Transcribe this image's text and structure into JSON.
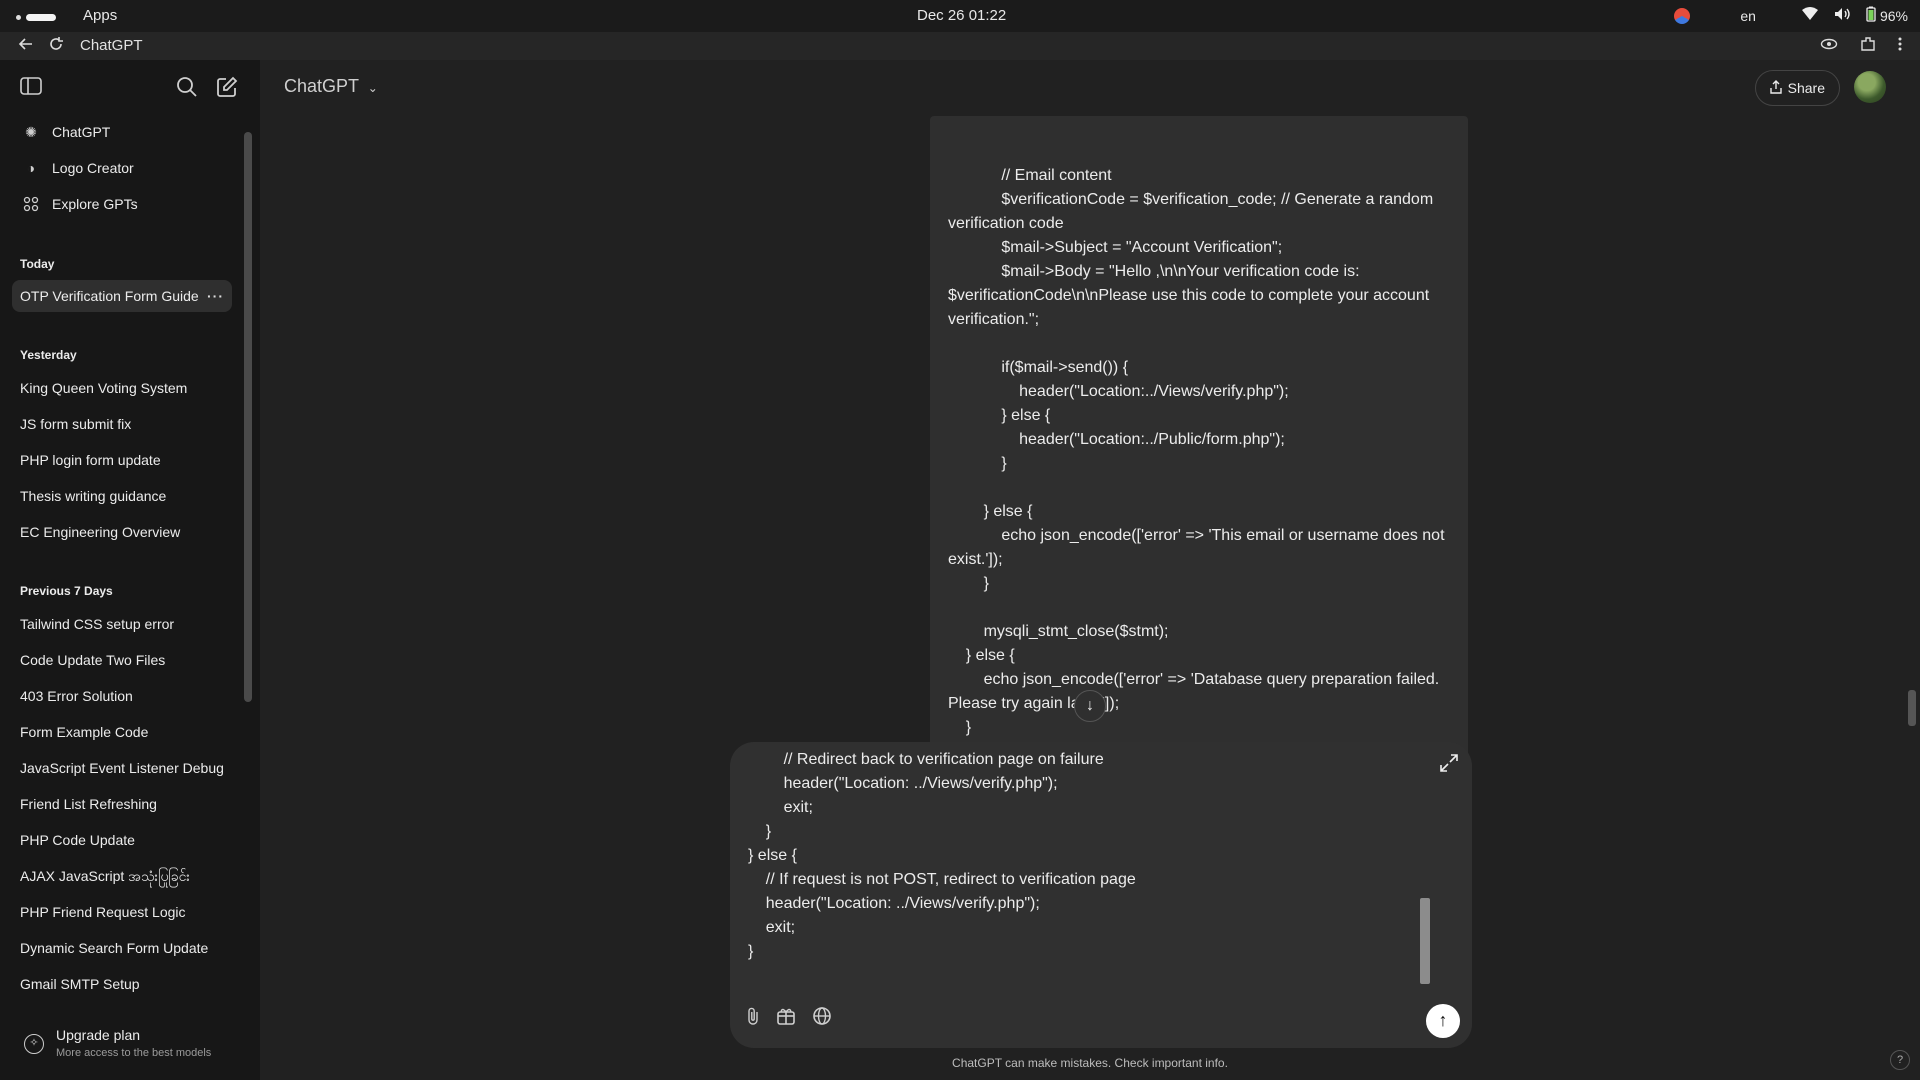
{
  "os_bar": {
    "apps_label": "Apps",
    "clock": "Dec 26  01:22",
    "language": "en",
    "battery": "96%"
  },
  "browser": {
    "tab_title": "ChatGPT"
  },
  "sidebar": {
    "nav": [
      {
        "label": "ChatGPT"
      },
      {
        "label": "Logo Creator"
      },
      {
        "label": "Explore GPTs"
      }
    ],
    "sections": {
      "today": "Today",
      "yesterday": "Yesterday",
      "previous": "Previous 7 Days"
    },
    "today_chats": [
      "OTP Verification Form Guide"
    ],
    "yesterday_chats": [
      "King Queen Voting System",
      "JS form submit fix",
      "PHP login form update",
      "Thesis writing guidance",
      "EC Engineering Overview"
    ],
    "previous_chats": [
      "Tailwind CSS setup error",
      "Code Update Two Files",
      "403 Error Solution",
      "Form Example Code",
      "JavaScript Event Listener Debug",
      "Friend List Refreshing",
      "PHP Code Update",
      "AJAX JavaScript အသုံးပြုခြင်း",
      "PHP Friend Request Logic",
      "Dynamic Search Form Update",
      "Gmail SMTP Setup"
    ],
    "upgrade": {
      "title": "Upgrade plan",
      "subtitle": "More access to the best models"
    }
  },
  "header": {
    "model": "ChatGPT",
    "share": "Share"
  },
  "message_text": "            // Email content\n            $verificationCode = $verification_code; // Generate a random verification code\n            $mail->Subject = \"Account Verification\";\n            $mail->Body = \"Hello ,\\n\\nYour verification code is: $verificationCode\\n\\nPlease use this code to complete your account verification.\";\n\n            if($mail->send()) {\n                header(\"Location:../Views/verify.php\");\n            } else {\n                header(\"Location:../Public/form.php\");\n            }\n\n        } else {\n            echo json_encode(['error' => 'This email or username does not exist.']);\n        }\n\n        mysqli_stmt_close($stmt);\n    } else {\n        echo json_encode(['error' => 'Database query preparation failed. Please try again later.']);\n    }\n} else {",
  "composer_text": "        // Redirect back to verification page on failure\n        header(\"Location: ../Views/verify.php\");\n        exit;\n    }\n} else {\n    // If request is not POST, redirect to verification page\n    header(\"Location: ../Views/verify.php\");\n    exit;\n}\n?> if OT{",
  "footer_note": "ChatGPT can make mistakes. Check important info.",
  "help": "?"
}
